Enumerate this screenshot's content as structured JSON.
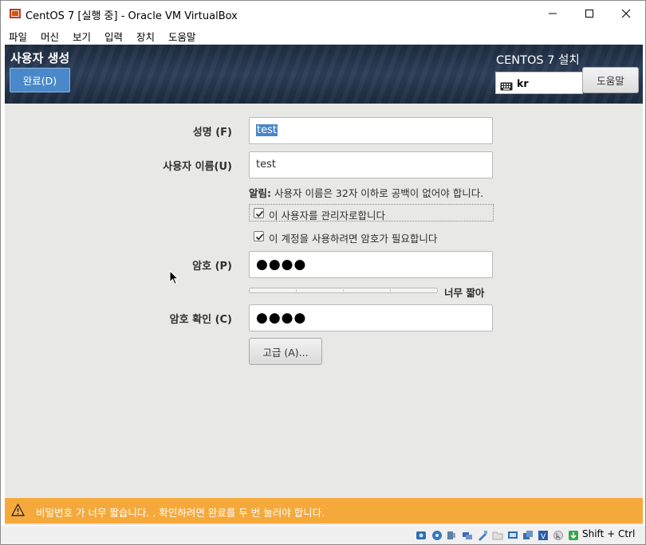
{
  "window": {
    "title": "CentOS 7 [실행 중] - Oracle VM VirtualBox"
  },
  "menu": [
    "파일",
    "머신",
    "보기",
    "입력",
    "장치",
    "도움말"
  ],
  "header": {
    "title": "사용자 생성",
    "done_label": "완료(D)",
    "os_title": "CENTOS 7 설치",
    "keyboard": "kr",
    "help_label": "도움말"
  },
  "form": {
    "fullname_label": "성명 (F)",
    "fullname_value": "test",
    "username_label": "사용자 이름(U)",
    "username_value": "test",
    "note_bold": "알림:",
    "note_text": " 사용자 이름은 32자 이하로 공백이 없어야 합니다.",
    "admin_checkbox": "이 사용자를 관리자로합니다",
    "require_pw_checkbox": "이 계정을 사용하려면 암호가 필요합니다",
    "password_label": "암호 (P)",
    "password_value": "●●●●",
    "strength_text": "너무 짧아",
    "confirm_label": "암호 확인 (C)",
    "confirm_value": "●●●●",
    "advanced_label": "고급 (A)..."
  },
  "warning": {
    "text": "비밀번호 가 너무 짧습니다. . 확인하려면 완료를 두 번 눌러야 합니다."
  },
  "statusbar": {
    "host_key": "Shift + Ctrl"
  },
  "colors": {
    "header_bg": "#24364d",
    "accent_blue": "#4a89c9",
    "warning_bg": "#f6a93b"
  }
}
